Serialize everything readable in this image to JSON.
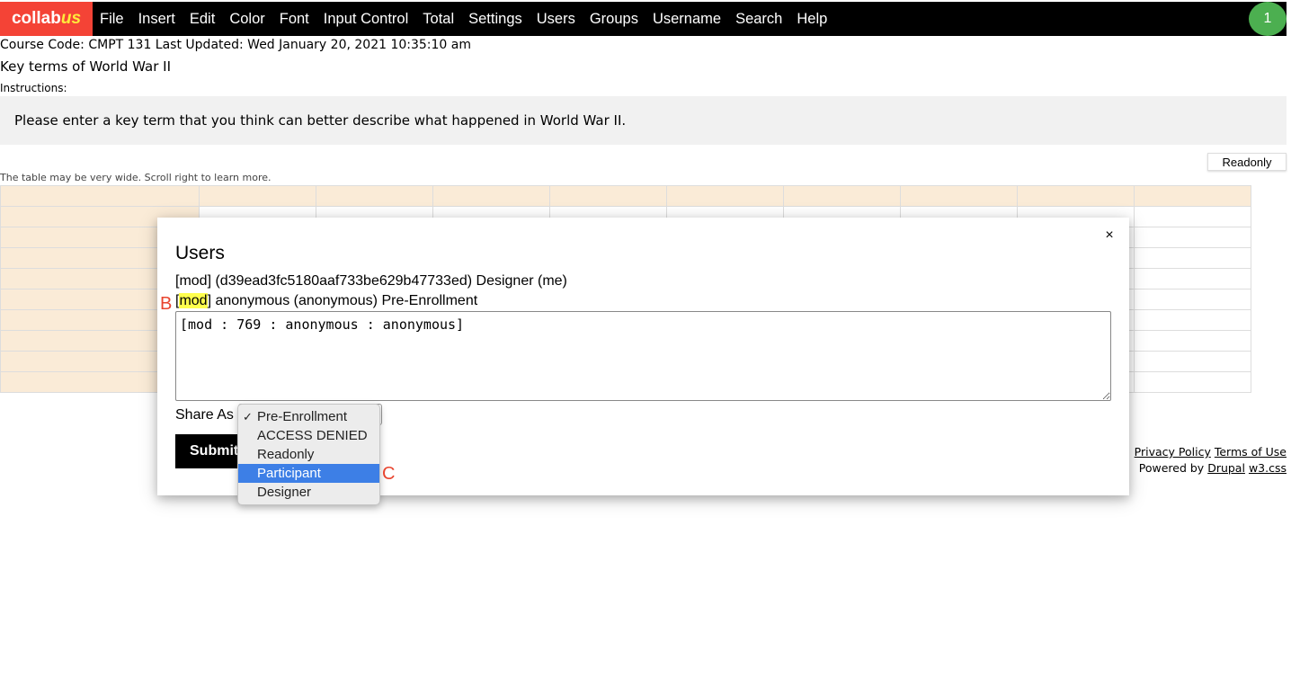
{
  "navbar": {
    "logo_main": "collab",
    "logo_accent": "us",
    "items": [
      "File",
      "Insert",
      "Edit",
      "Color",
      "Font",
      "Input Control",
      "Total",
      "Settings",
      "Users",
      "Groups",
      "Username",
      "Search",
      "Help"
    ],
    "badge": "1"
  },
  "page": {
    "course_info": "Course Code: CMPT 131  Last Updated: Wed January 20, 2021 10:35:10 am",
    "title": "Key terms of World War II",
    "instructions_label": "Instructions:",
    "instructions_text": "Please enter a key term that you think can better describe what happened in World War II.",
    "readonly_button": "Readonly",
    "scroll_note": "The table may be very wide. Scroll right to learn more."
  },
  "footer": {
    "privacy": "Privacy Policy",
    "terms": "Terms of Use",
    "powered_by": "Powered by",
    "drupal": "Drupal",
    "w3css": "w3.css"
  },
  "modal": {
    "title": "Users",
    "close": "×",
    "user1": "[mod] (d39ead3fc5180aaf733be629b47733ed) Designer (me)",
    "user2_prefix": "[",
    "user2_highlight": "mod",
    "user2_rest": "] anonymous (anonymous) Pre-Enrollment",
    "textarea_value": "[mod : 769 : anonymous : anonymous]",
    "share_as_label": "Share As",
    "submit_label": "Submit"
  },
  "dropdown": {
    "check": "✓",
    "options": [
      "Pre-Enrollment",
      "ACCESS DENIED",
      "Readonly",
      "Participant",
      "Designer"
    ],
    "selected": "Pre-Enrollment",
    "highlighted": "Participant"
  },
  "markers": {
    "b": "B",
    "c": "C"
  },
  "colors": {
    "navbar": "#000000",
    "logo": "#f44336",
    "badge": "#4caf50",
    "grid_header": "#faebd7",
    "highlight": "#ffff4d",
    "dropdown_active": "#3d7fe6",
    "marker": "#e8442e"
  }
}
